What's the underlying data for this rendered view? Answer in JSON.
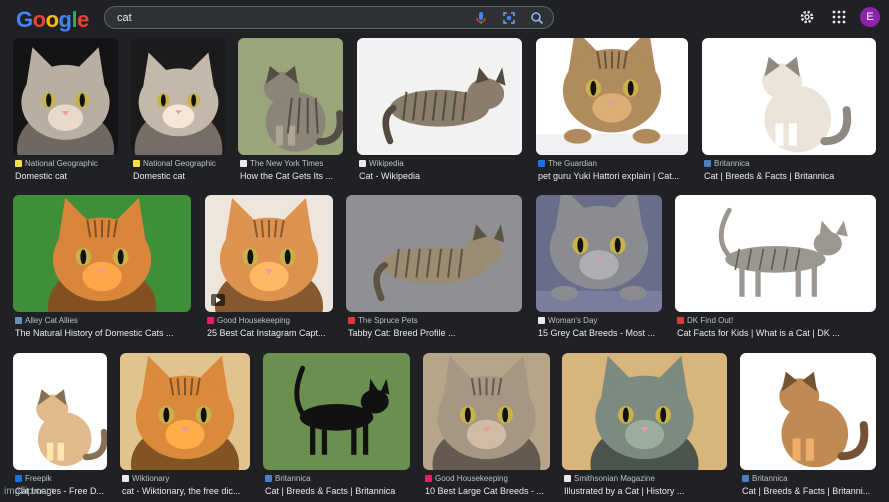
{
  "header": {
    "logo": [
      "G",
      "o",
      "o",
      "g",
      "l",
      "e"
    ],
    "search_value": "cat",
    "avatar_letter": "E"
  },
  "results": [
    {
      "source": "National Geographic",
      "title": "Domestic cat",
      "fav": "#f9e04b",
      "bg": "#141414",
      "fur": "#b9aea2",
      "stripe": false,
      "pose": "face"
    },
    {
      "source": "National Geographic",
      "title": "Domestic cat",
      "fav": "#f9e04b",
      "bg": "#1b1b1b",
      "fur": "#c4b8aa",
      "stripe": false,
      "pose": "face"
    },
    {
      "source": "The New York Times",
      "title": "How the Cat Gets Its ...",
      "fav": "#e8eaed",
      "bg": "#9aa57a",
      "fur": "#8b8477",
      "stripe": true,
      "pose": "sit"
    },
    {
      "source": "Wikipedia",
      "title": "Cat - Wikipedia",
      "fav": "#e8eaed",
      "bg": "#f2f2f0",
      "fur": "#8a7d6b",
      "stripe": true,
      "pose": "lie"
    },
    {
      "source": "The Guardian",
      "title": "pet guru Yuki Hattori explain | Cat...",
      "fav": "#1a73e8",
      "bg": "#ffffff",
      "fur": "#b08b5e",
      "stripe": true,
      "pose": "peek"
    },
    {
      "source": "Britannica",
      "title": "Cat | Breeds & Facts | Britannica",
      "fav": "#4a7fc1",
      "bg": "#ffffff",
      "fur": "#ece4da",
      "stripe": false,
      "pose": "sit"
    },
    {
      "source": "Alley Cat Allies",
      "title": "The Natural History of Domestic Cats ...",
      "fav": "#6d8fb3",
      "bg": "#3f8f3a",
      "fur": "#d9853b",
      "stripe": true,
      "pose": "face"
    },
    {
      "source": "Good Housekeeping",
      "title": "25 Best Cat Instagram Capt...",
      "fav": "#e91e63",
      "bg": "#eee6dc",
      "fur": "#dd9350",
      "stripe": true,
      "pose": "face"
    },
    {
      "source": "The Spruce Pets",
      "title": "Tabby Cat: Breed Profile ...",
      "fav": "#e53935",
      "bg": "#8f9093",
      "fur": "#9a8c72",
      "stripe": true,
      "pose": "lie"
    },
    {
      "source": "Woman's Day",
      "title": "15 Grey Cat Breeds - Most ...",
      "fav": "#e8eaed",
      "bg": "#6a6d8a",
      "fur": "#8a8c91",
      "stripe": false,
      "pose": "peek"
    },
    {
      "source": "DK Find Out!",
      "title": "Cat Facts for Kids | What is a Cat | DK ...",
      "fav": "#e53935",
      "bg": "#ffffff",
      "fur": "#9b9790",
      "stripe": true,
      "pose": "walk"
    },
    {
      "source": "Freepik",
      "title": "Cat Images - Free D...",
      "fav": "#1a73e8",
      "bg": "#ffffff",
      "fur": "#e0b98c",
      "stripe": false,
      "pose": "sit"
    },
    {
      "source": "Wiktionary",
      "title": "cat - Wiktionary, the free dic...",
      "fav": "#e8eaed",
      "bg": "#e2c28f",
      "fur": "#d98a3a",
      "stripe": true,
      "pose": "face"
    },
    {
      "source": "Britannica",
      "title": "Cat | Breeds & Facts | Britannica",
      "fav": "#4a7fc1",
      "bg": "#6b8f4f",
      "fur": "#111111",
      "stripe": false,
      "pose": "walk"
    },
    {
      "source": "Good Housekeeping",
      "title": "10 Best Large Cat Breeds - ...",
      "fav": "#e91e63",
      "bg": "#b7a58a",
      "fur": "#a69684",
      "stripe": true,
      "pose": "face"
    },
    {
      "source": "Smithsonian Magazine",
      "title": "Illustrated by a Cat | History ...",
      "fav": "#e8eaed",
      "bg": "#d8b57a",
      "fur": "#7c8a7f",
      "stripe": false,
      "pose": "face"
    },
    {
      "source": "Britannica",
      "title": "Cat | Breeds & Facts | Britanni...",
      "fav": "#4a7fc1",
      "bg": "#ffffff",
      "fur": "#c08a55",
      "stripe": false,
      "pose": "sit"
    }
  ],
  "watermark": "imgflip.com"
}
